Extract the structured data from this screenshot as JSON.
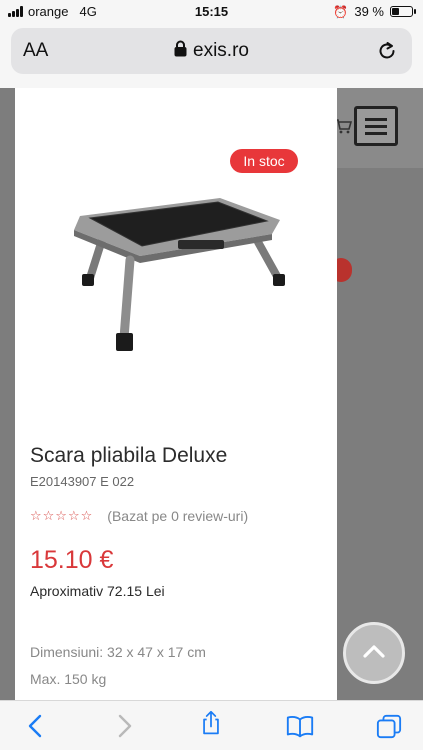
{
  "status_bar": {
    "carrier": "orange",
    "network": "4G",
    "time": "15:15",
    "battery": "39 %",
    "battery_level": 0.39,
    "icons": [
      "signal-icon",
      "alarm-icon",
      "battery-icon"
    ]
  },
  "browser": {
    "text_size_label": "AA",
    "url": "exis.ro",
    "icons": [
      "lock-icon",
      "reload-icon"
    ]
  },
  "product": {
    "badge": "In stoc",
    "title": "Scara pliabila Deluxe",
    "sku": "E20143907 E 022",
    "stars": "☆☆☆☆☆",
    "reviews": "(Bazat pe 0 review-uri)",
    "price": "15.10 €",
    "approx_price": "Aproximativ 72.15 Lei",
    "dimensions": "Dimensiuni: 32 x 47 x 17 cm",
    "max_load": "Max. 150 kg"
  },
  "toolbar": {
    "icons": [
      "back-icon",
      "forward-icon",
      "share-icon",
      "bookmarks-icon",
      "tabs-icon"
    ]
  },
  "colors": {
    "accent_red": "#e8373a",
    "price_red": "#d9383a",
    "ios_blue": "#1a7cf5"
  }
}
